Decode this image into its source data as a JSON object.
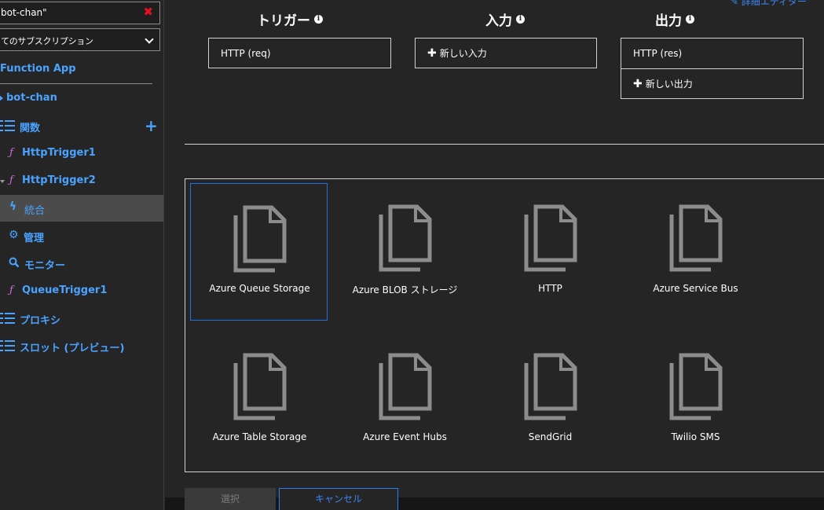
{
  "sidebar": {
    "search_value": "bot-chan\"",
    "subscription_value": "てのサブスクリプション",
    "section_title": "Function App",
    "items": [
      {
        "label": "bot-chan"
      },
      {
        "label": "関数"
      },
      {
        "label": "HttpTrigger1"
      },
      {
        "label": "HttpTrigger2"
      },
      {
        "label": "統合"
      },
      {
        "label": "管理"
      },
      {
        "label": "モニター"
      },
      {
        "label": "QueueTrigger1"
      },
      {
        "label": "プロキシ"
      },
      {
        "label": "スロット (プレビュー)"
      }
    ]
  },
  "main": {
    "advanced_editor": "詳細エディター",
    "trigger": {
      "title": "トリガー",
      "items": [
        "HTTP (req)"
      ]
    },
    "input": {
      "title": "入力",
      "new": "新しい入力"
    },
    "output": {
      "title": "出力",
      "items": [
        "HTTP (res)"
      ],
      "new": "新しい出力"
    },
    "templates": [
      {
        "label": "Azure Queue Storage"
      },
      {
        "label": "Azure BLOB ストレージ"
      },
      {
        "label": "HTTP"
      },
      {
        "label": "Azure Service Bus"
      },
      {
        "label": "Azure Table Storage"
      },
      {
        "label": "Azure Event Hubs"
      },
      {
        "label": "SendGrid"
      },
      {
        "label": "Twilio SMS"
      }
    ],
    "select_button": "選択",
    "cancel_button": "キャンセル"
  },
  "colors": {
    "accent": "#4aa3ff",
    "function_icon": "#c36fd6",
    "selected_tile_border": "#1f6fe5",
    "active_item_bg": "#4b4b4b",
    "clear_icon": "#e81123"
  }
}
